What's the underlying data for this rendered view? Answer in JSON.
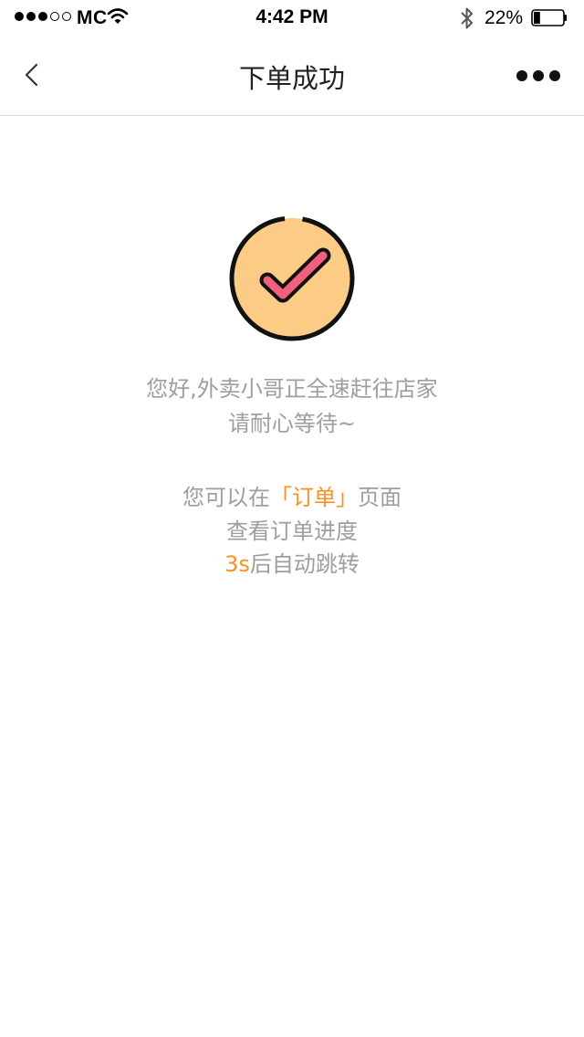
{
  "status_bar": {
    "carrier": "MC",
    "time": "4:42 PM",
    "battery_percent": "22%",
    "battery_level": 0.22,
    "signal_bars": 3,
    "signal_total": 5
  },
  "nav": {
    "title": "下单成功"
  },
  "colors": {
    "accent": "#ff8f1f",
    "icon_circle": "#fccb86",
    "check": "#f2607d",
    "message": "#9e9e9e"
  },
  "icons": {
    "success": "check-circle-icon",
    "back": "chevron-left-icon",
    "more": "more-dots-icon"
  },
  "message": {
    "line1": "您好,外卖小哥正全速赶往店家",
    "line2": "请耐心等待~"
  },
  "info": {
    "line1_prefix": "您可以在",
    "line1_link": "「订单」",
    "line1_suffix": "页面",
    "line2": "查看订单进度",
    "countdown": "3s",
    "line3_suffix": "后自动跳转"
  }
}
